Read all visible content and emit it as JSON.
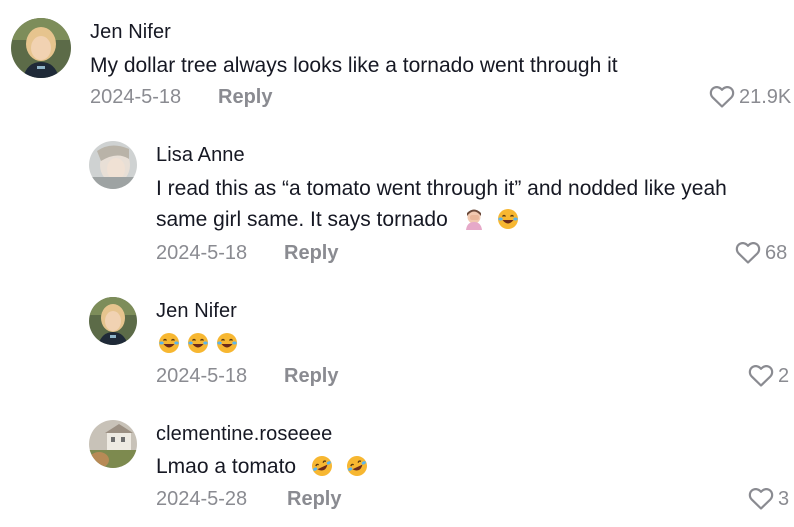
{
  "comments": [
    {
      "username": "Jen Nifer",
      "lines": [
        "My dollar tree always looks like a tornado went through it"
      ],
      "date": "2024-5-18",
      "reply_label": "Reply",
      "likes": "21.9K"
    },
    {
      "username": "Lisa Anne",
      "lines": [
        "I read this as “a tomato went through it” and nodded like yeah",
        "same girl same. It says tornado"
      ],
      "date": "2024-5-18",
      "reply_label": "Reply",
      "likes": "68"
    },
    {
      "username": "Jen Nifer",
      "lines": [
        ""
      ],
      "date": "2024-5-18",
      "reply_label": "Reply",
      "likes": "2"
    },
    {
      "username": "clementine.roseeee",
      "lines": [
        "Lmao a tomato"
      ],
      "date": "2024-5-28",
      "reply_label": "Reply",
      "likes": "3"
    }
  ],
  "emoji_icons": {
    "c2_line2": [
      "woman-facepalming-emoji",
      "face-with-tears-of-joy-emoji"
    ],
    "c3_line1": [
      "face-with-tears-of-joy-emoji",
      "face-with-tears-of-joy-emoji",
      "face-with-tears-of-joy-emoji"
    ],
    "c4_line1": [
      "rolling-on-floor-laughing-emoji",
      "rolling-on-floor-laughing-emoji"
    ]
  },
  "colors": {
    "text_primary": "#161823",
    "text_secondary": "#8a8b91",
    "background": "#ffffff",
    "emoji_yellow": "#f7b731"
  }
}
